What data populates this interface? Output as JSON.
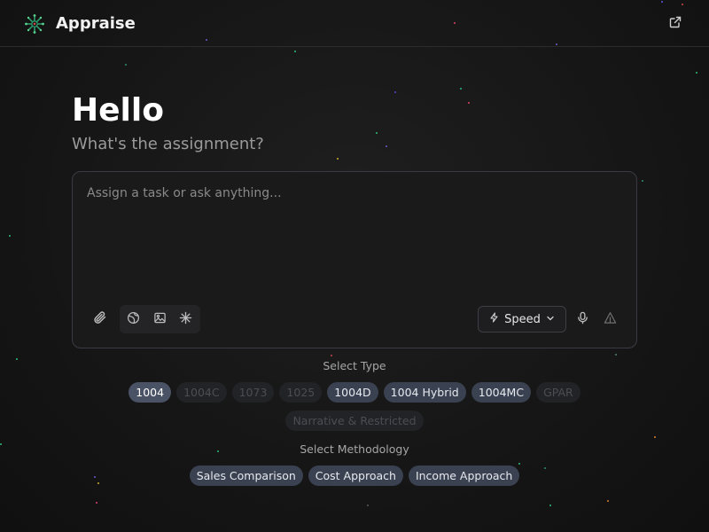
{
  "header": {
    "app_title": "Appraise",
    "logo_icon": "sparkle-logo-icon",
    "external_icon": "external-link-icon"
  },
  "hero": {
    "greeting": "Hello",
    "subtitle": "What's the assignment?"
  },
  "composer": {
    "placeholder": "Assign a task or ask anything...",
    "value": "",
    "mode_label": "Speed",
    "tools": [
      "attach-icon",
      "globe-icon",
      "image-icon",
      "asterisk-icon"
    ],
    "actions": [
      "mic-icon",
      "send-triangle-icon"
    ]
  },
  "type_section": {
    "label": "Select Type",
    "row1": [
      {
        "label": "1004",
        "state": "selected"
      },
      {
        "label": "1004C",
        "state": "disabled"
      },
      {
        "label": "1073",
        "state": "disabled"
      },
      {
        "label": "1025",
        "state": "disabled"
      },
      {
        "label": "1004D",
        "state": "enabled"
      },
      {
        "label": "1004 Hybrid",
        "state": "enabled"
      },
      {
        "label": "1004MC",
        "state": "enabled"
      },
      {
        "label": "GPAR",
        "state": "disabled"
      }
    ],
    "row2": [
      {
        "label": "Narrative & Restricted",
        "state": "disabled"
      }
    ]
  },
  "methodology_section": {
    "label": "Select Methodology",
    "chips": [
      {
        "label": "Sales Comparison",
        "state": "enabled"
      },
      {
        "label": "Cost Approach",
        "state": "enabled"
      },
      {
        "label": "Income Approach",
        "state": "enabled"
      }
    ]
  },
  "colors": {
    "accent_chip": "#3a4150",
    "selected_chip": "#4a5366",
    "disabled_chip": "#222326",
    "logo_green": "#2f9e6e"
  }
}
